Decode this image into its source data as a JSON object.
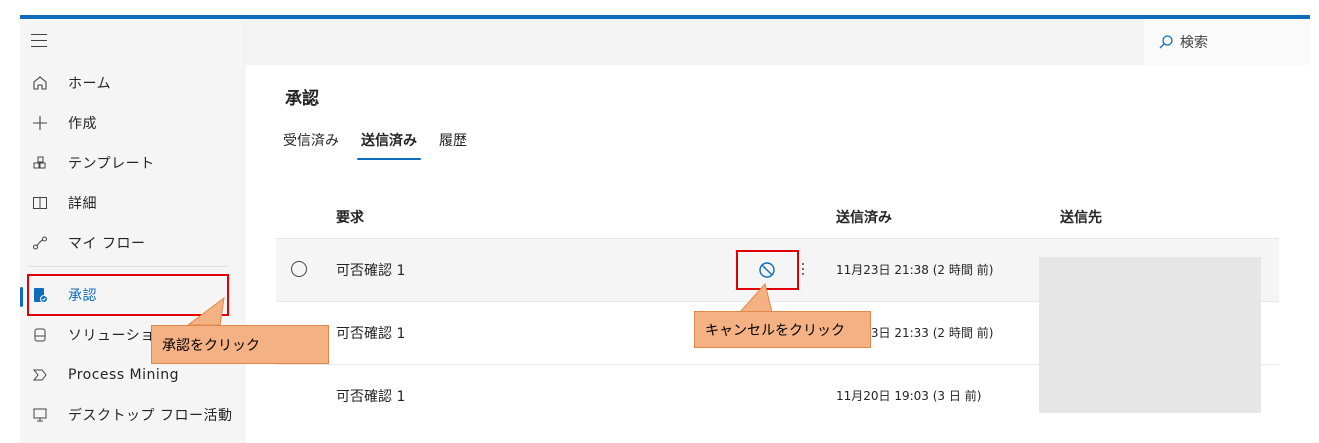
{
  "header": {
    "search_label": "検索"
  },
  "sidebar": {
    "items": [
      {
        "label": "ホーム",
        "icon": "home-icon"
      },
      {
        "label": "作成",
        "icon": "plus-icon"
      },
      {
        "label": "テンプレート",
        "icon": "template-icon"
      },
      {
        "label": "詳細",
        "icon": "book-icon"
      },
      {
        "label": "マイ フロー",
        "icon": "flow-icon"
      },
      {
        "label": "承認",
        "icon": "approval-icon",
        "active": true
      },
      {
        "label": "ソリューショ",
        "icon": "solution-icon"
      },
      {
        "label": "Process Mining",
        "icon": "process-mining-icon"
      },
      {
        "label": "デスクトップ フロー活動",
        "icon": "desktop-flow-icon"
      }
    ]
  },
  "main": {
    "title": "承認",
    "tabs": [
      {
        "label": "受信済み"
      },
      {
        "label": "送信済み",
        "active": true
      },
      {
        "label": "履歴"
      }
    ],
    "columns": {
      "request": "要求",
      "sent": "送信済み",
      "recipient": "送信先"
    },
    "rows": [
      {
        "title": "可否確認 1",
        "sent": "11月23日 21:38 (2 時間 前)"
      },
      {
        "title": "可否確認 1",
        "sent": "11月23日 21:33 (2 時間 前)"
      },
      {
        "title": "可否確認 1",
        "sent": "11月20日 19:03 (3 日 前)"
      }
    ]
  },
  "annotations": {
    "approval_callout": "承認をクリック",
    "cancel_callout": "キャンセルをクリック"
  },
  "colors": {
    "accent": "#0f6cbd",
    "highlight": "#e00000",
    "callout": "#f4b183"
  }
}
